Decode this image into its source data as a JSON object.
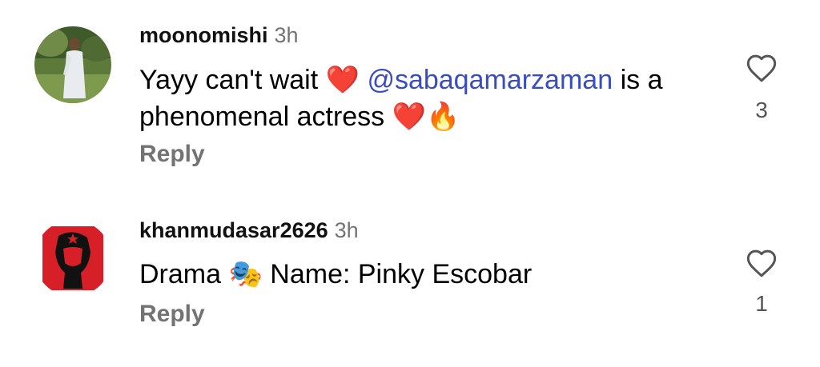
{
  "comments": [
    {
      "username": "moonomishi",
      "time": "3h",
      "text": {
        "part1": "Yayy can't wait",
        "emoji1": "❤️",
        "mention": "@sabaqamarzaman",
        "part2": "is a phenomenal actress",
        "emoji2": "❤️",
        "emoji3": "🔥"
      },
      "reply_label": "Reply",
      "like_count": "3",
      "like_icon": "heart-outline"
    },
    {
      "username": "khanmudasar2626",
      "time": "3h",
      "text": {
        "part1": "Drama",
        "emoji1": "🎭",
        "part2": "Name: Pinky Escobar"
      },
      "reply_label": "Reply",
      "like_count": "1",
      "like_icon": "heart-outline"
    }
  ],
  "colors": {
    "mention": "#3a4dbf",
    "secondary_text": "#737373",
    "avatar2_background": "#d61f26"
  }
}
